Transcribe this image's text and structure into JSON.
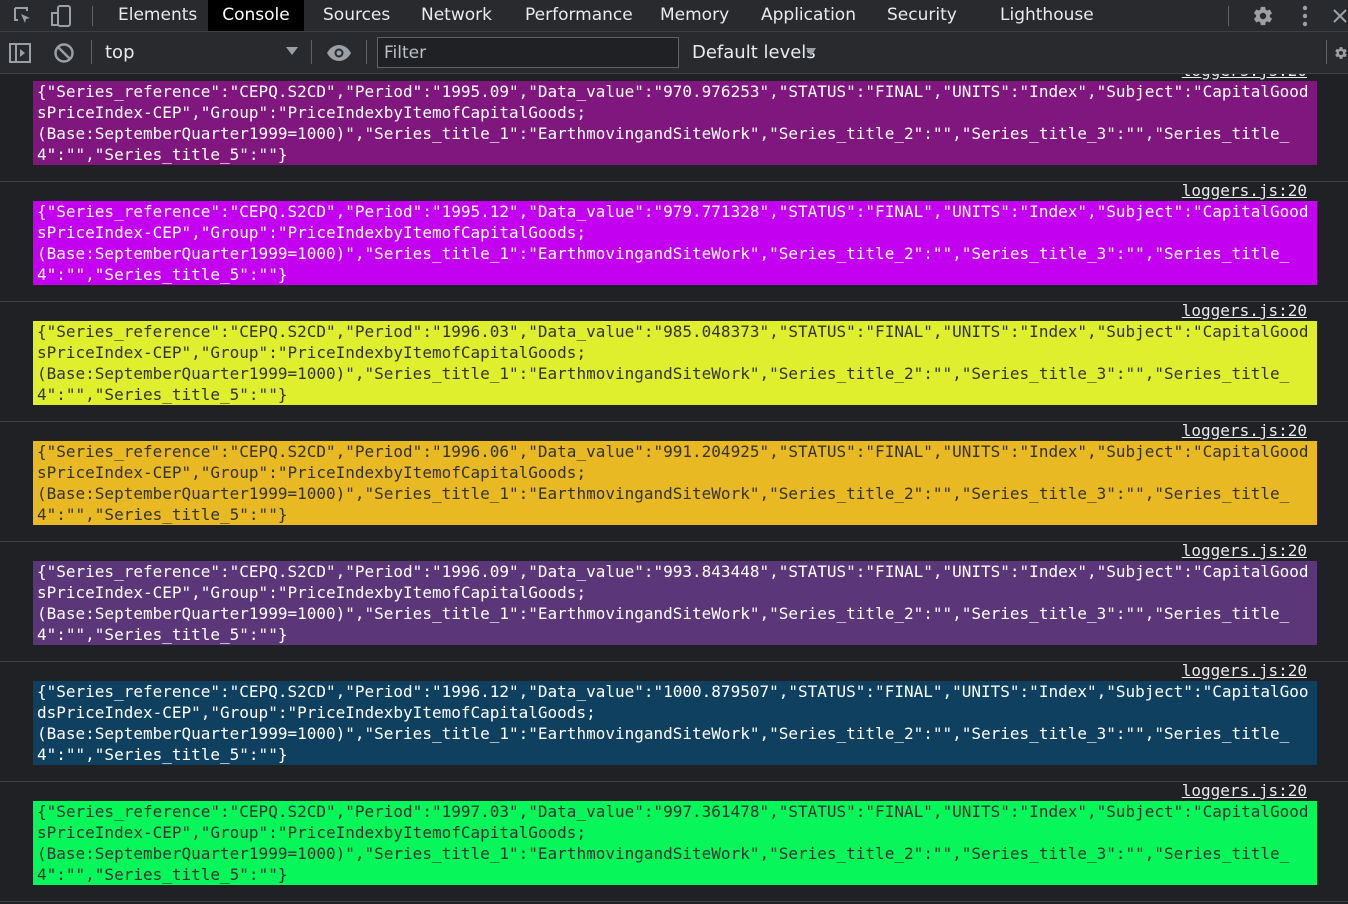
{
  "tabs": [
    {
      "label": "Elements"
    },
    {
      "label": "Console"
    },
    {
      "label": "Sources"
    },
    {
      "label": "Network"
    },
    {
      "label": "Performance"
    },
    {
      "label": "Memory"
    },
    {
      "label": "Application"
    },
    {
      "label": "Security"
    },
    {
      "label": "Lighthouse"
    }
  ],
  "active_tab": "Console",
  "toolbar": {
    "context": "top",
    "filter_placeholder": "Filter",
    "levels": "Default levels"
  },
  "log_source": "loggers.js:20",
  "entries": [
    {
      "text": "{\"Series_reference\":\"CEPQ.S2CD\",\"Period\":\"1995.09\",\"Data_value\":\"970.976253\",\"STATUS\":\"FINAL\",\"UNITS\":\"Index\",\"Subject\":\"CapitalGoodsPriceIndex-CEP\",\"Group\":\"PriceIndexbyItemofCapitalGoods;\n(Base:SeptemberQuarter1999=1000)\",\"Series_title_1\":\"EarthmovingandSiteWork\",\"Series_title_2\":\"\",\"Series_title_3\":\"\",\"Series_title_4\":\"\",\"Series_title_5\":\"\"}",
      "bg": "#80177f",
      "fg": "#ffffff"
    },
    {
      "text": "{\"Series_reference\":\"CEPQ.S2CD\",\"Period\":\"1995.12\",\"Data_value\":\"979.771328\",\"STATUS\":\"FINAL\",\"UNITS\":\"Index\",\"Subject\":\"CapitalGoodsPriceIndex-CEP\",\"Group\":\"PriceIndexbyItemofCapitalGoods;\n(Base:SeptemberQuarter1999=1000)\",\"Series_title_1\":\"EarthmovingandSiteWork\",\"Series_title_2\":\"\",\"Series_title_3\":\"\",\"Series_title_4\":\"\",\"Series_title_5\":\"\"}",
      "bg": "#c400f0",
      "fg": "#ffffff"
    },
    {
      "text": "{\"Series_reference\":\"CEPQ.S2CD\",\"Period\":\"1996.03\",\"Data_value\":\"985.048373\",\"STATUS\":\"FINAL\",\"UNITS\":\"Index\",\"Subject\":\"CapitalGoodsPriceIndex-CEP\",\"Group\":\"PriceIndexbyItemofCapitalGoods;\n(Base:SeptemberQuarter1999=1000)\",\"Series_title_1\":\"EarthmovingandSiteWork\",\"Series_title_2\":\"\",\"Series_title_3\":\"\",\"Series_title_4\":\"\",\"Series_title_5\":\"\"}",
      "bg": "#e0ef2d",
      "fg": "#333333"
    },
    {
      "text": "{\"Series_reference\":\"CEPQ.S2CD\",\"Period\":\"1996.06\",\"Data_value\":\"991.204925\",\"STATUS\":\"FINAL\",\"UNITS\":\"Index\",\"Subject\":\"CapitalGoodsPriceIndex-CEP\",\"Group\":\"PriceIndexbyItemofCapitalGoods;\n(Base:SeptemberQuarter1999=1000)\",\"Series_title_1\":\"EarthmovingandSiteWork\",\"Series_title_2\":\"\",\"Series_title_3\":\"\",\"Series_title_4\":\"\",\"Series_title_5\":\"\"}",
      "bg": "#e9b923",
      "fg": "#333333"
    },
    {
      "text": "{\"Series_reference\":\"CEPQ.S2CD\",\"Period\":\"1996.09\",\"Data_value\":\"993.843448\",\"STATUS\":\"FINAL\",\"UNITS\":\"Index\",\"Subject\":\"CapitalGoodsPriceIndex-CEP\",\"Group\":\"PriceIndexbyItemofCapitalGoods;\n(Base:SeptemberQuarter1999=1000)\",\"Series_title_1\":\"EarthmovingandSiteWork\",\"Series_title_2\":\"\",\"Series_title_3\":\"\",\"Series_title_4\":\"\",\"Series_title_5\":\"\"}",
      "bg": "#5b3678",
      "fg": "#ffffff"
    },
    {
      "text": "{\"Series_reference\":\"CEPQ.S2CD\",\"Period\":\"1996.12\",\"Data_value\":\"1000.879507\",\"STATUS\":\"FINAL\",\"UNITS\":\"Index\",\"Subject\":\"CapitalGoodsPriceIndex-CEP\",\"Group\":\"PriceIndexbyItemofCapitalGoods;\n(Base:SeptemberQuarter1999=1000)\",\"Series_title_1\":\"EarthmovingandSiteWork\",\"Series_title_2\":\"\",\"Series_title_3\":\"\",\"Series_title_4\":\"\",\"Series_title_5\":\"\"}",
      "bg": "#0f4060",
      "fg": "#ffffff"
    },
    {
      "text": "{\"Series_reference\":\"CEPQ.S2CD\",\"Period\":\"1997.03\",\"Data_value\":\"997.361478\",\"STATUS\":\"FINAL\",\"UNITS\":\"Index\",\"Subject\":\"CapitalGoodsPriceIndex-CEP\",\"Group\":\"PriceIndexbyItemofCapitalGoods;\n(Base:SeptemberQuarter1999=1000)\",\"Series_title_1\":\"EarthmovingandSiteWork\",\"Series_title_2\":\"\",\"Series_title_3\":\"\",\"Series_title_4\":\"\",\"Series_title_5\":\"\"}",
      "bg": "#07f75b",
      "fg": "#333333"
    }
  ],
  "icons": {
    "inspect": "inspect-element-icon",
    "device": "device-toolbar-icon",
    "settings": "gear-icon",
    "more": "more-vert-icon",
    "close": "close-icon",
    "sidebar": "sidebar-toggle-icon",
    "clear": "clear-console-icon",
    "live": "eye-icon"
  }
}
